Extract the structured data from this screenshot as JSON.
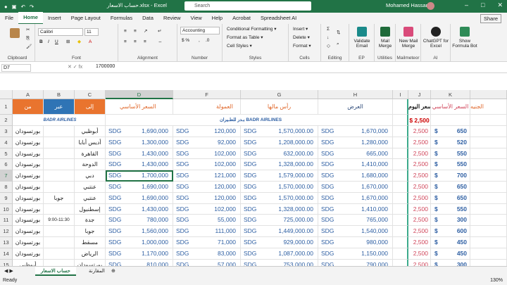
{
  "titlebar": {
    "title": "حساب الاسعار.xlsx  -  Excel",
    "search_placeholder": "Search",
    "user": "Mohamed Hassan",
    "share": "Share"
  },
  "tabs": [
    "File",
    "Home",
    "Insert",
    "Page Layout",
    "Formulas",
    "Data",
    "Review",
    "View",
    "Help",
    "Acrobat",
    "Spreadsheet AI"
  ],
  "ribbon": {
    "font_name": "Calibri",
    "font_size": "11",
    "number_format": "Accounting",
    "conditional_formatting": "Conditional Formatting ▾",
    "format_as_table": "Format as Table ▾",
    "cell_styles": "Cell Styles ▾",
    "insert": "Insert ▾",
    "delete": "Delete ▾",
    "format": "Format ▾",
    "clipboard": "Clipboard",
    "font": "Font",
    "alignment": "Alignment",
    "number": "Number",
    "styles": "Styles",
    "cells": "Cells",
    "editing": "Editing",
    "validate": "Validate Email",
    "mail_merge": "Mail Merge",
    "new_mail_merge": "New Mail Merge",
    "chatgpt": "ChatGPT for Excel",
    "formula_bot": "Show Formula Bot",
    "ep": "EP",
    "utilities": "Utilities",
    "mailmeteor": "Mailmeteor",
    "ai": "AI"
  },
  "formula_bar": {
    "name_box": "D7",
    "value": "1700000"
  },
  "columns": [
    "A",
    "B",
    "C",
    "D",
    "F",
    "G",
    "H",
    "I",
    "J",
    "K"
  ],
  "rows": [
    "1",
    "2",
    "3",
    "4",
    "5",
    "6",
    "7",
    "8",
    "9",
    "10",
    "11",
    "12",
    "13",
    "14",
    "15",
    "16"
  ],
  "header_row": {
    "a": "من",
    "b": "عبر",
    "c": "إلى",
    "d": "السعر الأساسي",
    "f": "العمولة",
    "g": "رأس مالها",
    "h": "العرض",
    "j": "سعر اليوم :",
    "k": "السعر الأساسي",
    "l": "الجنيه"
  },
  "logo": {
    "arabic": "بـدر للطـيران",
    "english": "BADR AIRLINES"
  },
  "today_rate": "$    2,500",
  "data_rows": [
    {
      "a": "بورتسودان",
      "b": "",
      "c": "أبوظبي",
      "d": "1,690,000",
      "f": "120,000",
      "g": "1,570,000.00",
      "h": "1,670,000",
      "j": "2,500",
      "k": "650"
    },
    {
      "a": "بورتسودان",
      "b": "",
      "c": "أديس أبابا",
      "d": "1,300,000",
      "f": "92,000",
      "g": "1,208,000.00",
      "h": "1,280,000",
      "j": "2,500",
      "k": "520"
    },
    {
      "a": "بورتسودان",
      "b": "",
      "c": "القاهرة",
      "d": "1,430,000",
      "f": "102,000",
      "g": "632,000.00",
      "h": "665,000",
      "j": "2,500",
      "k": "550"
    },
    {
      "a": "بورتسودان",
      "b": "",
      "c": "الدوحة",
      "d": "1,430,000",
      "f": "102,000",
      "g": "1,328,000.00",
      "h": "1,410,000",
      "j": "2,500",
      "k": "550"
    },
    {
      "a": "بورتسودان",
      "b": "",
      "c": "دبي",
      "d": "1,700,000",
      "f": "121,000",
      "g": "1,579,000.00",
      "h": "1,680,000",
      "j": "2,500",
      "k": "700"
    },
    {
      "a": "بورتسودان",
      "b": "",
      "c": "عنتبي",
      "d": "1,690,000",
      "f": "120,000",
      "g": "1,570,000.00",
      "h": "1,670,000",
      "j": "2,500",
      "k": "650"
    },
    {
      "a": "بورتسودان",
      "b": "جوبا",
      "c": "عنتبي",
      "d": "1,690,000",
      "f": "120,000",
      "g": "1,570,000.00",
      "h": "1,670,000",
      "j": "2,500",
      "k": "650"
    },
    {
      "a": "بورتسودان",
      "b": "",
      "c": "إسطنبول",
      "d": "1,430,000",
      "f": "102,000",
      "g": "1,328,000.00",
      "h": "1,410,000",
      "j": "2,500",
      "k": "550"
    },
    {
      "a": "بورتسودان",
      "b": "9:00-11:30",
      "c": "جدة",
      "d": "780,000",
      "f": "55,000",
      "g": "725,000.00",
      "h": "765,000",
      "j": "2,500",
      "k": "300"
    },
    {
      "a": "بورتسودان",
      "b": "",
      "c": "جوبا",
      "d": "1,560,000",
      "f": "111,000",
      "g": "1,449,000.00",
      "h": "1,540,000",
      "j": "2,500",
      "k": "600"
    },
    {
      "a": "بورتسودان",
      "b": "",
      "c": "مسقط",
      "d": "1,000,000",
      "f": "71,000",
      "g": "929,000.00",
      "h": "980,000",
      "j": "2,500",
      "k": "450"
    },
    {
      "a": "بورتسودان",
      "b": "",
      "c": "الرياض",
      "d": "1,170,000",
      "f": "83,000",
      "g": "1,087,000.00",
      "h": "1,150,000",
      "j": "2,500",
      "k": "450"
    },
    {
      "a": "أبوظبي",
      "b": "",
      "c": "بورتسودان",
      "d": "810,000",
      "f": "57,000",
      "g": "753,000.00",
      "h": "790,000",
      "j": "2,500",
      "k": "300"
    },
    {
      "a": "أديس أبابا",
      "b": "",
      "c": "بورتسودان",
      "d": "1,215,000",
      "f": "86,000",
      "g": "1,129,000.00",
      "h": "1,200,000",
      "j": "2,500",
      "k": "450"
    }
  ],
  "currency": "SDG",
  "dollar": "$",
  "sheets": [
    "حساب الاسعار",
    "المقارنة"
  ],
  "status": {
    "ready": "Ready",
    "zoom": "130%"
  }
}
